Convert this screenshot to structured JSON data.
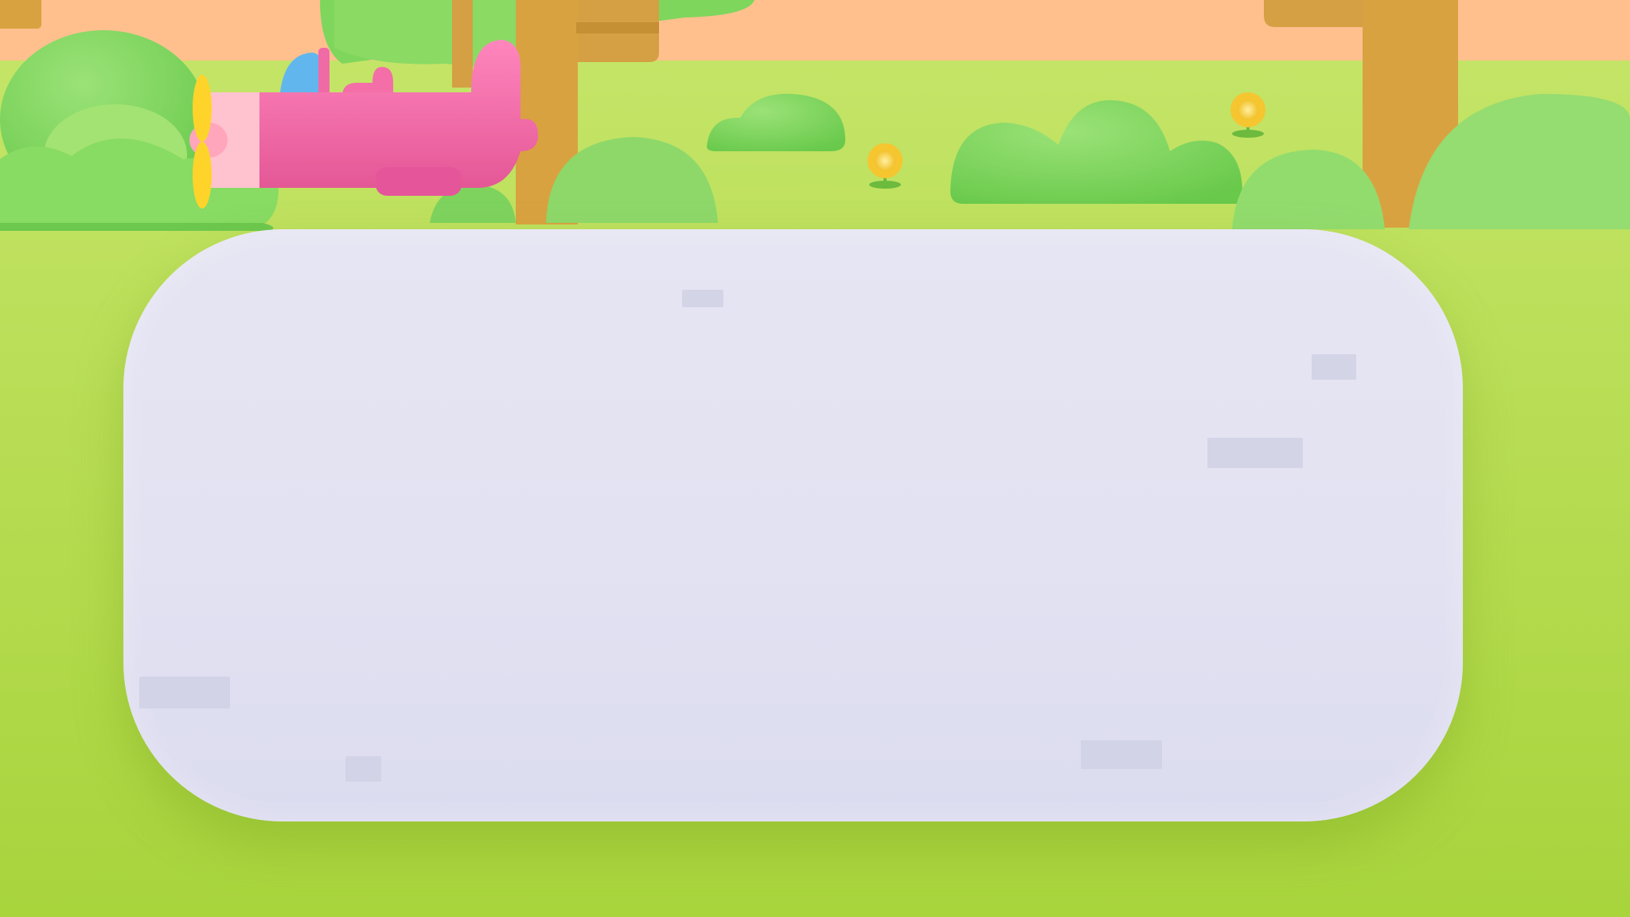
{
  "scene": {
    "name": "meadow-panel-screen",
    "colors": {
      "sky": "#ffc08e",
      "grass": "#c6e56a",
      "grass_dark": "#a7d43f",
      "bush": "#7fd65c",
      "bush_light": "#98de74",
      "trunk": "#d9a240",
      "plane_body": "#f46ea8",
      "plane_nose": "#ffc3cf",
      "propeller": "#ffd42a",
      "cockpit": "#62b6ee",
      "flower": "#f7cd3a",
      "panel": "#e3e3f2"
    }
  },
  "icons": {
    "plane": "pink-airplane-icon",
    "flower": "sunflower-icon"
  },
  "panel": {
    "title": "",
    "body": ""
  }
}
